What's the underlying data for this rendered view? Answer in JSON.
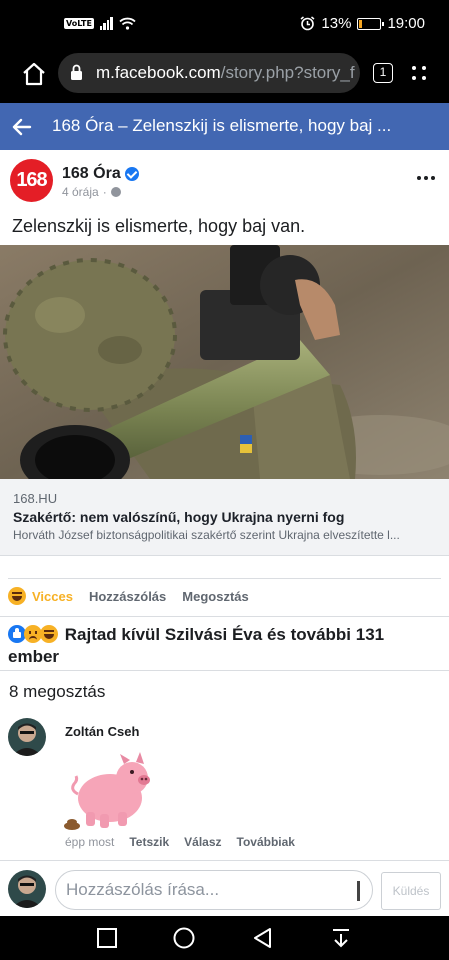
{
  "status_bar": {
    "volte": "VoLTE",
    "battery_pct": "13%",
    "time": "19:00"
  },
  "browser": {
    "url_domain": "m.facebook.com",
    "url_path": "/story.php?story_f",
    "tab_count": "1"
  },
  "header": {
    "title": "168 Óra – Zelenszkij is elismerte, hogy baj ..."
  },
  "post": {
    "avatar_text": "168",
    "page_name": "168 Óra",
    "time_ago": "4 órája",
    "separator": "·",
    "text": "Zelenszkij is elismerte, hogy baj van."
  },
  "link_preview": {
    "domain": "168.HU",
    "title": "Szakértő: nem valószínű, hogy Ukrajna nyerni fog",
    "description": "Horváth József biztonságpolitikai szakértő szerint Ukrajna elveszítette l..."
  },
  "actions": {
    "reaction": "Vicces",
    "comment": "Hozzászólás",
    "share": "Megosztás"
  },
  "reactions_summary": "Rajtad kívül Szilvási Éva és további 131 ember",
  "shares_count": "8 megosztás",
  "comment": {
    "author": "Zoltán Cseh",
    "time": "épp most",
    "like": "Tetszik",
    "reply": "Válasz",
    "more": "Továbbiak"
  },
  "composer": {
    "placeholder": "Hozzászólás írása...",
    "send": "Küldés"
  },
  "colors": {
    "facebook_blue": "#4267b2",
    "haha_yellow": "#f7b125",
    "brand_red": "#e41e26"
  }
}
